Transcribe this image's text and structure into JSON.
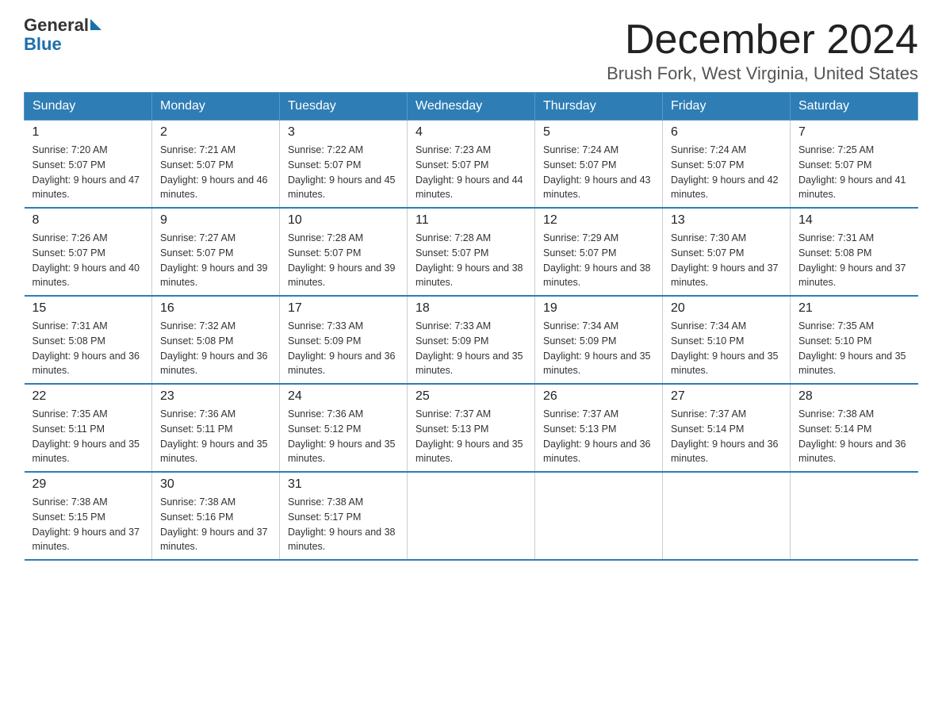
{
  "header": {
    "logo_general": "General",
    "logo_blue": "Blue",
    "title": "December 2024",
    "subtitle": "Brush Fork, West Virginia, United States"
  },
  "days_of_week": [
    "Sunday",
    "Monday",
    "Tuesday",
    "Wednesday",
    "Thursday",
    "Friday",
    "Saturday"
  ],
  "weeks": [
    [
      {
        "day": "1",
        "sunrise": "7:20 AM",
        "sunset": "5:07 PM",
        "daylight": "9 hours and 47 minutes."
      },
      {
        "day": "2",
        "sunrise": "7:21 AM",
        "sunset": "5:07 PM",
        "daylight": "9 hours and 46 minutes."
      },
      {
        "day": "3",
        "sunrise": "7:22 AM",
        "sunset": "5:07 PM",
        "daylight": "9 hours and 45 minutes."
      },
      {
        "day": "4",
        "sunrise": "7:23 AM",
        "sunset": "5:07 PM",
        "daylight": "9 hours and 44 minutes."
      },
      {
        "day": "5",
        "sunrise": "7:24 AM",
        "sunset": "5:07 PM",
        "daylight": "9 hours and 43 minutes."
      },
      {
        "day": "6",
        "sunrise": "7:24 AM",
        "sunset": "5:07 PM",
        "daylight": "9 hours and 42 minutes."
      },
      {
        "day": "7",
        "sunrise": "7:25 AM",
        "sunset": "5:07 PM",
        "daylight": "9 hours and 41 minutes."
      }
    ],
    [
      {
        "day": "8",
        "sunrise": "7:26 AM",
        "sunset": "5:07 PM",
        "daylight": "9 hours and 40 minutes."
      },
      {
        "day": "9",
        "sunrise": "7:27 AM",
        "sunset": "5:07 PM",
        "daylight": "9 hours and 39 minutes."
      },
      {
        "day": "10",
        "sunrise": "7:28 AM",
        "sunset": "5:07 PM",
        "daylight": "9 hours and 39 minutes."
      },
      {
        "day": "11",
        "sunrise": "7:28 AM",
        "sunset": "5:07 PM",
        "daylight": "9 hours and 38 minutes."
      },
      {
        "day": "12",
        "sunrise": "7:29 AM",
        "sunset": "5:07 PM",
        "daylight": "9 hours and 38 minutes."
      },
      {
        "day": "13",
        "sunrise": "7:30 AM",
        "sunset": "5:07 PM",
        "daylight": "9 hours and 37 minutes."
      },
      {
        "day": "14",
        "sunrise": "7:31 AM",
        "sunset": "5:08 PM",
        "daylight": "9 hours and 37 minutes."
      }
    ],
    [
      {
        "day": "15",
        "sunrise": "7:31 AM",
        "sunset": "5:08 PM",
        "daylight": "9 hours and 36 minutes."
      },
      {
        "day": "16",
        "sunrise": "7:32 AM",
        "sunset": "5:08 PM",
        "daylight": "9 hours and 36 minutes."
      },
      {
        "day": "17",
        "sunrise": "7:33 AM",
        "sunset": "5:09 PM",
        "daylight": "9 hours and 36 minutes."
      },
      {
        "day": "18",
        "sunrise": "7:33 AM",
        "sunset": "5:09 PM",
        "daylight": "9 hours and 35 minutes."
      },
      {
        "day": "19",
        "sunrise": "7:34 AM",
        "sunset": "5:09 PM",
        "daylight": "9 hours and 35 minutes."
      },
      {
        "day": "20",
        "sunrise": "7:34 AM",
        "sunset": "5:10 PM",
        "daylight": "9 hours and 35 minutes."
      },
      {
        "day": "21",
        "sunrise": "7:35 AM",
        "sunset": "5:10 PM",
        "daylight": "9 hours and 35 minutes."
      }
    ],
    [
      {
        "day": "22",
        "sunrise": "7:35 AM",
        "sunset": "5:11 PM",
        "daylight": "9 hours and 35 minutes."
      },
      {
        "day": "23",
        "sunrise": "7:36 AM",
        "sunset": "5:11 PM",
        "daylight": "9 hours and 35 minutes."
      },
      {
        "day": "24",
        "sunrise": "7:36 AM",
        "sunset": "5:12 PM",
        "daylight": "9 hours and 35 minutes."
      },
      {
        "day": "25",
        "sunrise": "7:37 AM",
        "sunset": "5:13 PM",
        "daylight": "9 hours and 35 minutes."
      },
      {
        "day": "26",
        "sunrise": "7:37 AM",
        "sunset": "5:13 PM",
        "daylight": "9 hours and 36 minutes."
      },
      {
        "day": "27",
        "sunrise": "7:37 AM",
        "sunset": "5:14 PM",
        "daylight": "9 hours and 36 minutes."
      },
      {
        "day": "28",
        "sunrise": "7:38 AM",
        "sunset": "5:14 PM",
        "daylight": "9 hours and 36 minutes."
      }
    ],
    [
      {
        "day": "29",
        "sunrise": "7:38 AM",
        "sunset": "5:15 PM",
        "daylight": "9 hours and 37 minutes."
      },
      {
        "day": "30",
        "sunrise": "7:38 AM",
        "sunset": "5:16 PM",
        "daylight": "9 hours and 37 minutes."
      },
      {
        "day": "31",
        "sunrise": "7:38 AM",
        "sunset": "5:17 PM",
        "daylight": "9 hours and 38 minutes."
      },
      {
        "day": "",
        "sunrise": "",
        "sunset": "",
        "daylight": ""
      },
      {
        "day": "",
        "sunrise": "",
        "sunset": "",
        "daylight": ""
      },
      {
        "day": "",
        "sunrise": "",
        "sunset": "",
        "daylight": ""
      },
      {
        "day": "",
        "sunrise": "",
        "sunset": "",
        "daylight": ""
      }
    ]
  ]
}
